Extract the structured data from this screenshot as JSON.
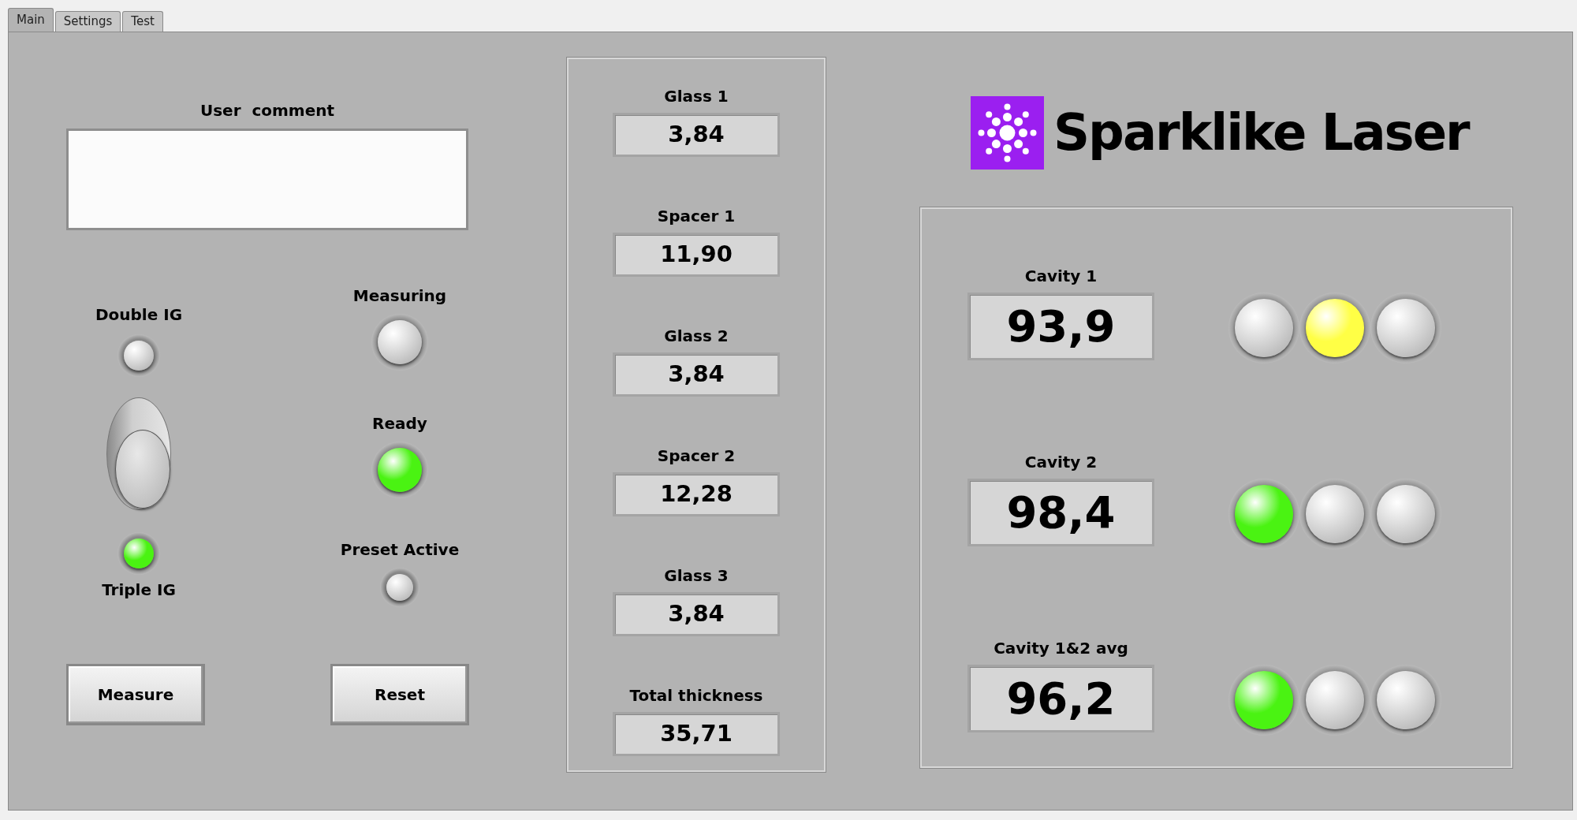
{
  "tabs": [
    {
      "label": "Main",
      "selected": true
    },
    {
      "label": "Settings",
      "selected": false
    },
    {
      "label": "Test",
      "selected": false
    }
  ],
  "user_comment": {
    "label": "User  comment"
  },
  "ig_mode": {
    "options": [
      {
        "label": "Double IG",
        "selected": false
      },
      {
        "label": "Triple IG",
        "selected": true
      }
    ]
  },
  "status_indicators": [
    {
      "label": "Measuring",
      "on": false,
      "kind": "large"
    },
    {
      "label": "Ready",
      "on": true,
      "kind": "large"
    },
    {
      "label": "Preset Active",
      "on": false,
      "kind": "small"
    }
  ],
  "buttons": [
    "Measure",
    "Reset"
  ],
  "thickness": [
    {
      "label": "Glass 1",
      "value": "3,84"
    },
    {
      "label": "Spacer 1",
      "value": "11,90"
    },
    {
      "label": "Glass 2",
      "value": "3,84"
    },
    {
      "label": "Spacer 2",
      "value": "12,28"
    },
    {
      "label": "Glass 3",
      "value": "3,84"
    },
    {
      "label": "Total thickness",
      "value": "35,71"
    }
  ],
  "logo": {
    "text": "Sparklike Laser"
  },
  "cavities": [
    {
      "label": "Cavity 1",
      "value": "93,9",
      "lamps": [
        {
          "on": false
        },
        {
          "on": true,
          "color": "#ffff55"
        },
        {
          "on": false
        }
      ]
    },
    {
      "label": "Cavity 2",
      "value": "98,4",
      "lamps": [
        {
          "on": true,
          "color": "#55ee22"
        },
        {
          "on": false
        },
        {
          "on": false
        }
      ]
    },
    {
      "label": "Cavity 1&2 avg",
      "value": "96,2",
      "lamps": [
        {
          "on": true,
          "color": "#55ee22"
        },
        {
          "on": false
        },
        {
          "on": false
        }
      ]
    }
  ]
}
